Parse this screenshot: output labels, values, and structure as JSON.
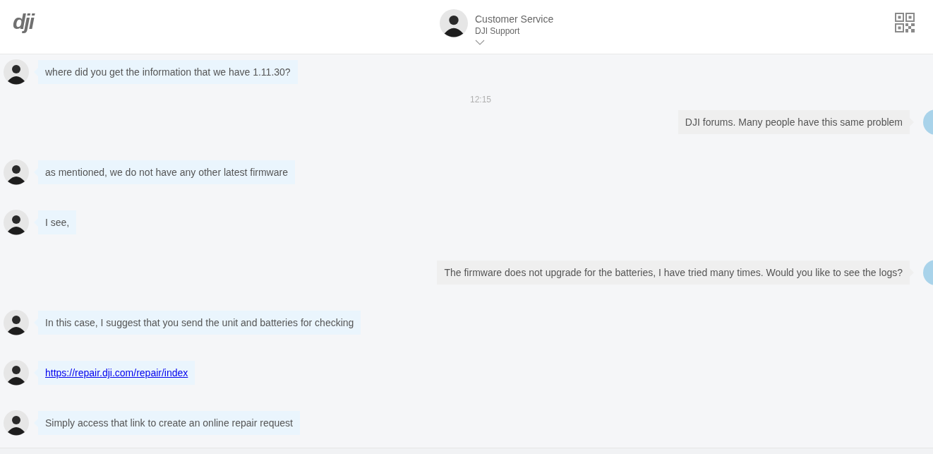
{
  "header": {
    "logo": "dji",
    "agent_name": "Customer Service",
    "agent_team": "DJI Support"
  },
  "messages": [
    {
      "kind": "agent",
      "text": "where did you get the information that we have 1.11.30?"
    },
    {
      "kind": "time",
      "text": "12:15"
    },
    {
      "kind": "user",
      "text": "DJI forums. Many people have this same problem"
    },
    {
      "kind": "agent",
      "text": "as mentioned, we do not have any other latest firmware"
    },
    {
      "kind": "agent",
      "text": "I see,"
    },
    {
      "kind": "user",
      "text": "The firmware does not upgrade for the batteries, I have tried many times. Would you like to see the logs?"
    },
    {
      "kind": "agent",
      "text": "In this case, I suggest that you send the unit and batteries for checking"
    },
    {
      "kind": "agent_link",
      "text": "https://repair.dji.com/repair/index"
    },
    {
      "kind": "agent",
      "text": "Simply access that link to create an online repair request"
    }
  ]
}
